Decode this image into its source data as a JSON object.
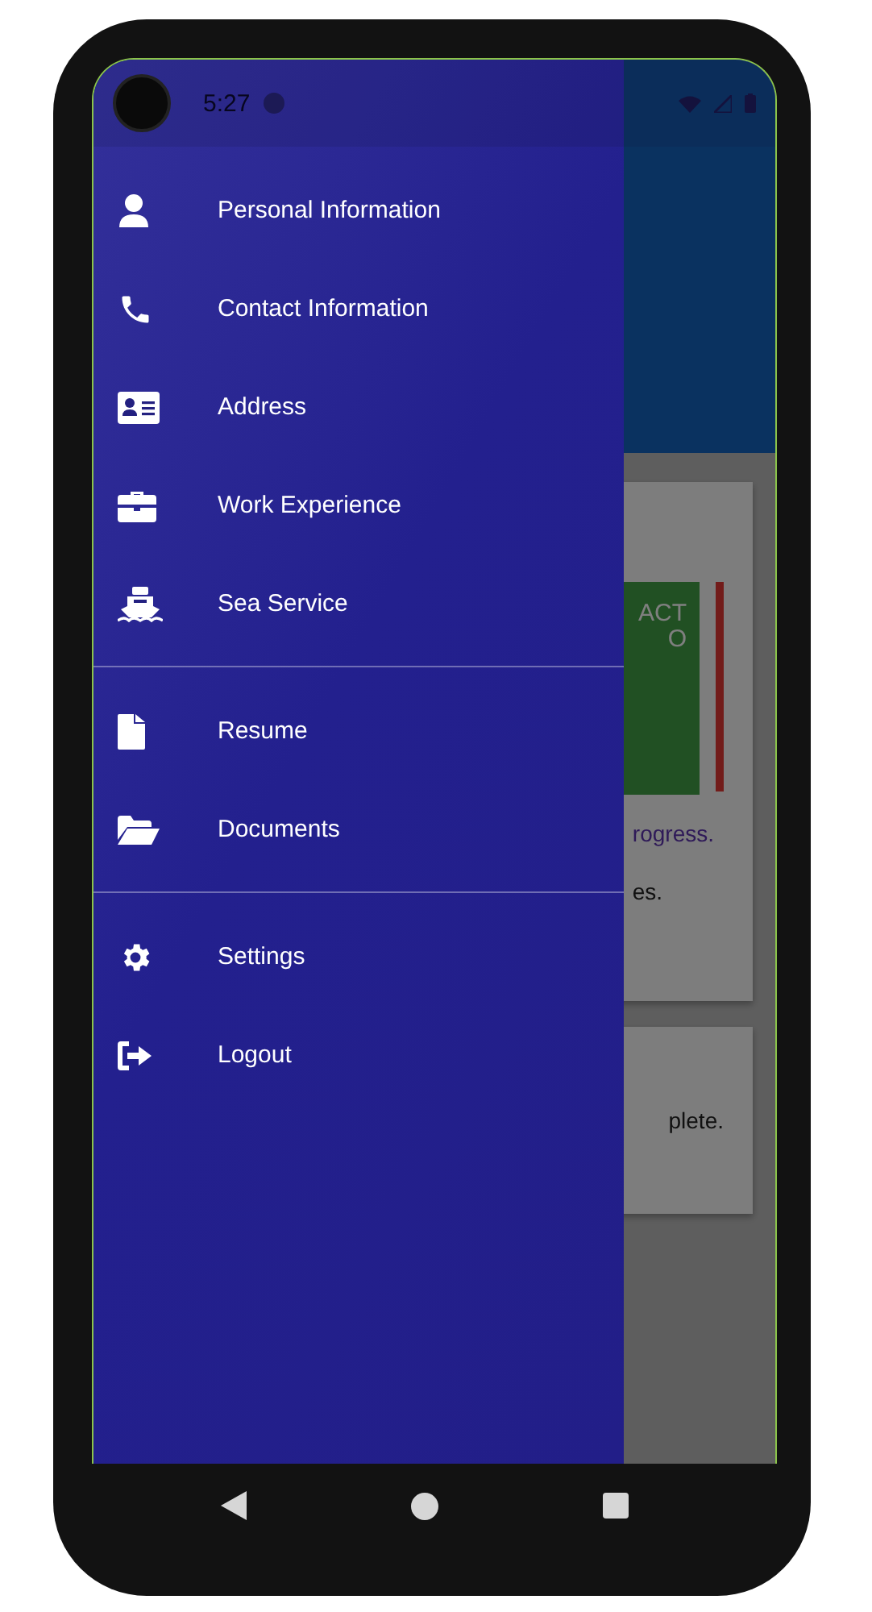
{
  "status_bar": {
    "time": "5:27"
  },
  "background": {
    "card_1": {
      "banner_line_1": "ACT",
      "banner_line_2": "O",
      "progress_text": "rogress.",
      "body_text": "es."
    },
    "card_2": {
      "body_text": "plete."
    }
  },
  "drawer": {
    "sections": [
      {
        "items": [
          {
            "label": "Personal Information"
          },
          {
            "label": "Contact Information"
          },
          {
            "label": "Address"
          },
          {
            "label": "Work Experience"
          },
          {
            "label": "Sea Service"
          }
        ]
      },
      {
        "items": [
          {
            "label": "Resume"
          },
          {
            "label": "Documents"
          }
        ]
      },
      {
        "items": [
          {
            "label": "Settings"
          },
          {
            "label": "Logout"
          }
        ]
      }
    ]
  }
}
